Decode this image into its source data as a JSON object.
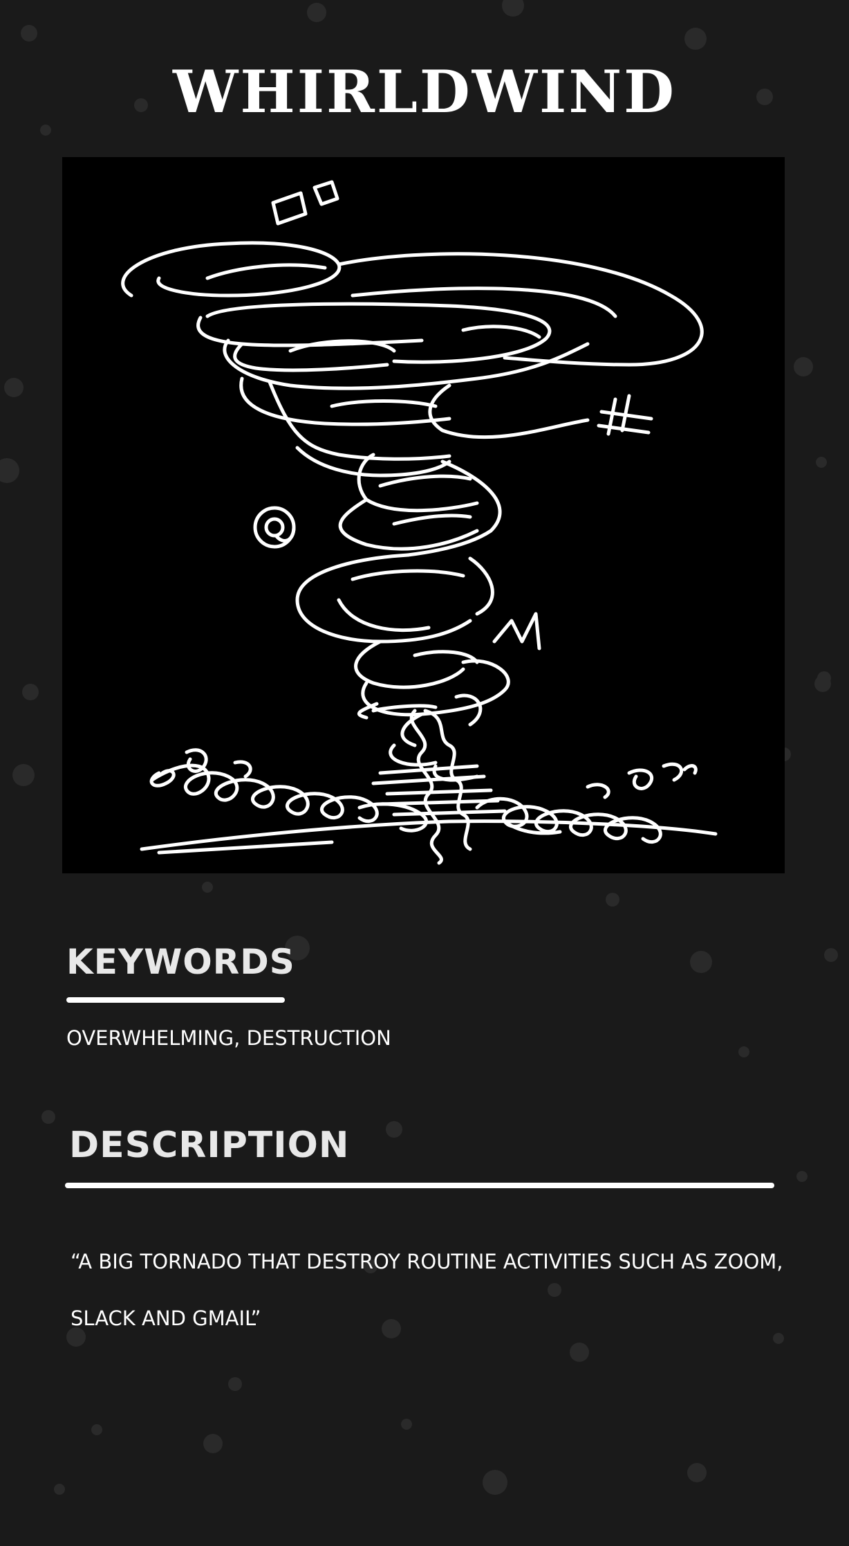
{
  "page": {
    "title": "WHIRLDWIND",
    "background_color": "#1a1a1a",
    "text_color": "#ffffff"
  },
  "illustration": {
    "subject": "tornado-sketch",
    "symbols": [
      "@",
      "#",
      "M"
    ]
  },
  "keywords": {
    "heading": "KEYWORDS",
    "text": "OVERWHELMING, DESTRUCTION"
  },
  "description": {
    "heading": "DESCRIPTION",
    "text": "“A BIG TORNADO THAT DESTROY ROUTINE ACTIVITIES SUCH AS ZOOM, SLACK AND GMAIL”"
  }
}
